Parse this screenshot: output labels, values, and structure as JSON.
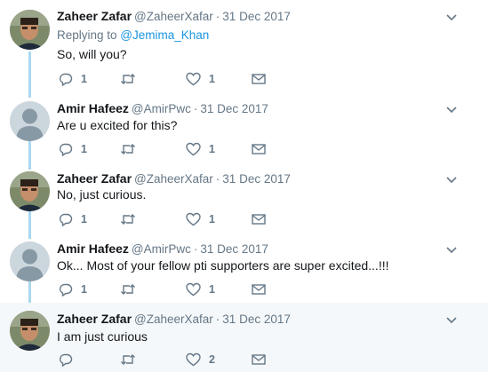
{
  "tweets": [
    {
      "name": "Zaheer Zafar",
      "handle": "@ZaheerXafar",
      "date": "31 Dec 2017",
      "reply_prefix": "Replying to ",
      "reply_to": "@Jemima_Khan",
      "text": "So, will you?",
      "reply_count": "1",
      "like_count": "1",
      "avatar": "photo-avatar"
    },
    {
      "name": "Amir Hafeez",
      "handle": "@AmirPwc",
      "date": "31 Dec 2017",
      "text": "Are u excited for this?",
      "reply_count": "1",
      "like_count": "1",
      "avatar": "default-avatar"
    },
    {
      "name": "Zaheer Zafar",
      "handle": "@ZaheerXafar",
      "date": "31 Dec 2017",
      "text": "No, just curious.",
      "reply_count": "1",
      "like_count": "1",
      "avatar": "photo-avatar"
    },
    {
      "name": "Amir Hafeez",
      "handle": "@AmirPwc",
      "date": "31 Dec 2017",
      "text": "Ok... Most of your fellow pti supporters are super excited...!!!",
      "reply_count": "1",
      "like_count": "1",
      "avatar": "default-avatar"
    },
    {
      "name": "Zaheer Zafar",
      "handle": "@ZaheerXafar",
      "date": "31 Dec 2017",
      "text": "I am just curious",
      "reply_count": "",
      "like_count": "2",
      "avatar": "photo-avatar"
    }
  ],
  "separator": "·",
  "icons": {
    "reply": "reply-icon",
    "retweet": "retweet-icon",
    "like": "heart-icon",
    "message": "envelope-icon",
    "menu": "chevron-down-icon"
  },
  "colors": {
    "link": "#1b95e0",
    "muted": "#657786",
    "thread_line": "#aad8f0",
    "highlight_bg": "#f5f8fa"
  }
}
